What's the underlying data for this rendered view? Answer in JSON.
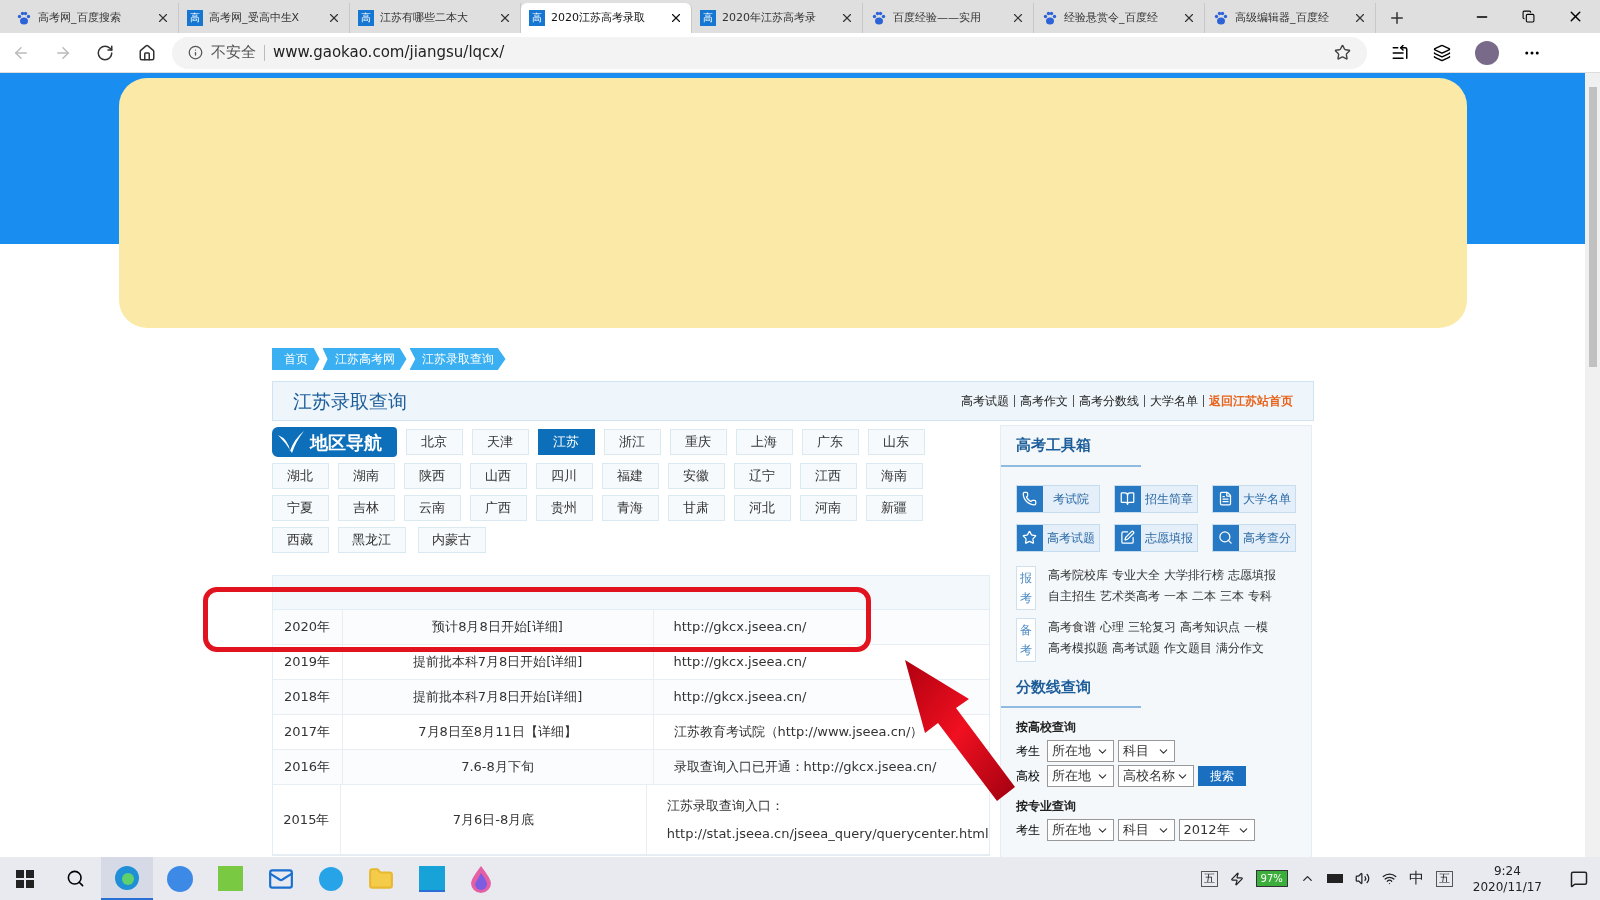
{
  "tabs": [
    {
      "icon": {
        "kind": "paw"
      },
      "title": "高考网_百度搜索",
      "selected": false
    },
    {
      "icon": {
        "kind": "letter",
        "text": "高"
      },
      "title": "高考网_受高中生X",
      "selected": false
    },
    {
      "icon": {
        "kind": "letter",
        "text": "高"
      },
      "title": "江苏有哪些二本大",
      "selected": false
    },
    {
      "icon": {
        "kind": "letter",
        "text": "高"
      },
      "title": "2020江苏高考录取",
      "selected": true
    },
    {
      "icon": {
        "kind": "letter",
        "text": "高"
      },
      "title": "2020年江苏高考录",
      "selected": false
    },
    {
      "icon": {
        "kind": "paw"
      },
      "title": "百度经验——实用",
      "selected": false
    },
    {
      "icon": {
        "kind": "paw"
      },
      "title": "经验悬赏令_百度经",
      "selected": false
    },
    {
      "icon": {
        "kind": "paw"
      },
      "title": "高级编辑器_百度经",
      "selected": false
    }
  ],
  "address": {
    "security": "不安全",
    "url": "www.gaokao.com/jiangsu/lqcx/"
  },
  "breadcrumb": [
    "首页",
    "江苏高考网",
    "江苏录取查询"
  ],
  "header": {
    "title": "江苏录取查询",
    "links": [
      {
        "text": "高考试题",
        "highlight": false
      },
      {
        "text": "高考作文",
        "highlight": false
      },
      {
        "text": "高考分数线",
        "highlight": false
      },
      {
        "text": "大学名单",
        "highlight": false
      },
      {
        "text": "返回江苏站首页",
        "highlight": true
      }
    ]
  },
  "region_nav": {
    "title": "地区导航",
    "regions": [
      {
        "name": "北京",
        "selected": false
      },
      {
        "name": "天津",
        "selected": false
      },
      {
        "name": "江苏",
        "selected": true
      },
      {
        "name": "浙江",
        "selected": false
      },
      {
        "name": "重庆",
        "selected": false
      },
      {
        "name": "上海",
        "selected": false
      },
      {
        "name": "广东",
        "selected": false
      },
      {
        "name": "山东",
        "selected": false
      },
      {
        "name": "湖北",
        "selected": false
      },
      {
        "name": "湖南",
        "selected": false
      },
      {
        "name": "陕西",
        "selected": false
      },
      {
        "name": "山西",
        "selected": false
      },
      {
        "name": "四川",
        "selected": false
      },
      {
        "name": "福建",
        "selected": false
      },
      {
        "name": "安徽",
        "selected": false
      },
      {
        "name": "辽宁",
        "selected": false
      },
      {
        "name": "江西",
        "selected": false
      },
      {
        "name": "海南",
        "selected": false
      },
      {
        "name": "宁夏",
        "selected": false
      },
      {
        "name": "吉林",
        "selected": false
      },
      {
        "name": "云南",
        "selected": false
      },
      {
        "name": "广西",
        "selected": false
      },
      {
        "name": "贵州",
        "selected": false
      },
      {
        "name": "青海",
        "selected": false
      },
      {
        "name": "甘肃",
        "selected": false
      },
      {
        "name": "河北",
        "selected": false
      },
      {
        "name": "河南",
        "selected": false
      },
      {
        "name": "新疆",
        "selected": false
      },
      {
        "name": "西藏",
        "selected": false
      },
      {
        "name": "黑龙江",
        "selected": false
      },
      {
        "name": "内蒙古",
        "selected": false
      }
    ]
  },
  "table": {
    "rows": [
      {
        "year": "2020年",
        "time": "预计8月8日开始[详细]",
        "entry": [
          "http://gkcx.jseea.cn/"
        ]
      },
      {
        "year": "2019年",
        "time": "提前批本科7月8日开始[详细]",
        "entry": [
          "http://gkcx.jseea.cn/"
        ]
      },
      {
        "year": "2018年",
        "time": "提前批本科7月8日开始[详细]",
        "entry": [
          "http://gkcx.jseea.cn/"
        ]
      },
      {
        "year": "2017年",
        "time": "7月8日至8月11日【详细】",
        "entry": [
          "江苏教育考试院（http://www.jseea.cn/）"
        ]
      },
      {
        "year": "2016年",
        "time": "7.6-8月下旬",
        "entry": [
          "录取查询入口已开通：http://gkcx.jseea.cn/"
        ]
      },
      {
        "year": "2015年",
        "time": "7月6日-8月底",
        "entry": [
          "江苏录取查询入口：",
          "http://stat.jseea.cn/jseea_query/querycenter.html"
        ]
      }
    ]
  },
  "toolbox": {
    "title": "高考工具箱",
    "tools": [
      {
        "kind": "phone",
        "label": "考试院"
      },
      {
        "kind": "book",
        "label": "招生简章"
      },
      {
        "kind": "list",
        "label": "大学名单"
      },
      {
        "kind": "star",
        "label": "高考试题"
      },
      {
        "kind": "edit",
        "label": "志愿填报"
      },
      {
        "kind": "search",
        "label": "高考查分"
      }
    ],
    "link_groups": [
      {
        "tag": "报考",
        "lines": [
          [
            "高考院校库",
            "专业大全",
            "大学排行榜",
            "志愿填报"
          ],
          [
            "自主招生",
            "艺术类高考",
            "一本",
            "二本",
            "三本",
            "专科"
          ]
        ]
      },
      {
        "tag": "备考",
        "lines": [
          [
            "高考食谱",
            "心理",
            "三轮复习",
            "高考知识点",
            "一模"
          ],
          [
            "高考模拟题",
            "高考试题",
            "作文题目",
            "满分作文"
          ]
        ]
      }
    ]
  },
  "score_query": {
    "title": "分数线查询",
    "groups": [
      {
        "title": "按高校查询",
        "rows": [
          {
            "label": "考生",
            "selects": [
              "所在地",
              "科目"
            ]
          },
          {
            "label": "高校",
            "selects": [
              "所在地",
              "高校名称"
            ],
            "button": "搜索"
          }
        ]
      },
      {
        "title": "按专业查询",
        "rows": [
          {
            "label": "考生",
            "selects": [
              "所在地",
              "科目",
              "2012年"
            ]
          }
        ]
      }
    ]
  },
  "taskbar": {
    "ime": "五",
    "battery": "97%",
    "lang": "中",
    "ime2": "五",
    "time": "9:24",
    "date": "2020/11/17"
  }
}
